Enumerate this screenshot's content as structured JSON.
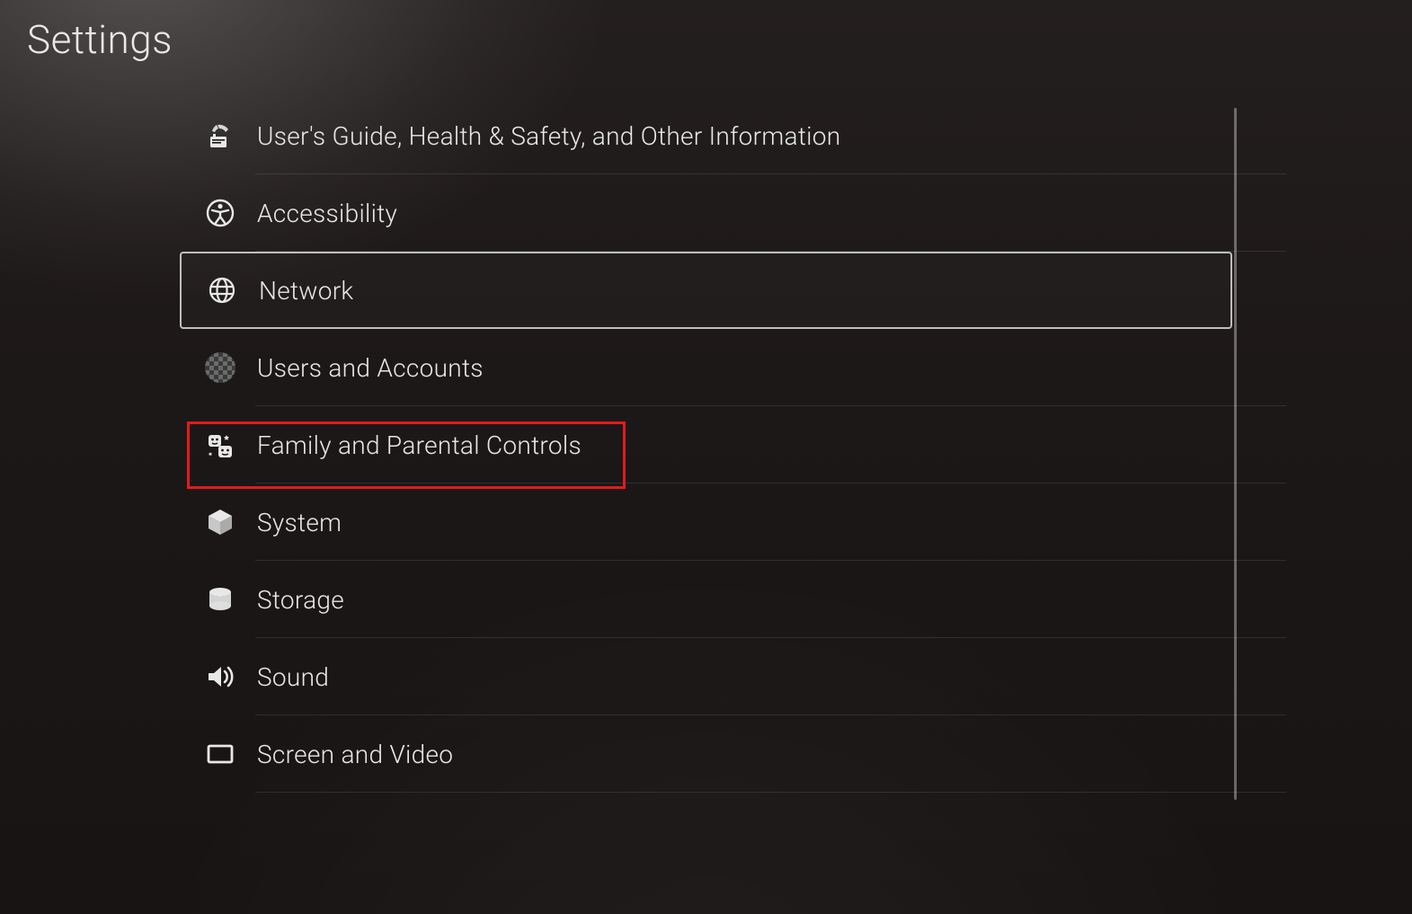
{
  "page_title": "Settings",
  "menu": {
    "items": [
      {
        "id": "guide",
        "label": "User's Guide, Health & Safety, and Other Information",
        "icon": "guide-icon",
        "selected": false,
        "highlight": false
      },
      {
        "id": "accessibility",
        "label": "Accessibility",
        "icon": "accessibility-icon",
        "selected": false,
        "highlight": false
      },
      {
        "id": "network",
        "label": "Network",
        "icon": "globe-icon",
        "selected": true,
        "highlight": false
      },
      {
        "id": "users",
        "label": "Users and Accounts",
        "icon": "avatar-icon",
        "selected": false,
        "highlight": false
      },
      {
        "id": "family",
        "label": "Family and Parental Controls",
        "icon": "family-icon",
        "selected": false,
        "highlight": true
      },
      {
        "id": "system",
        "label": "System",
        "icon": "cube-icon",
        "selected": false,
        "highlight": false
      },
      {
        "id": "storage",
        "label": "Storage",
        "icon": "storage-icon",
        "selected": false,
        "highlight": false
      },
      {
        "id": "sound",
        "label": "Sound",
        "icon": "speaker-icon",
        "selected": false,
        "highlight": false
      },
      {
        "id": "screen",
        "label": "Screen and Video",
        "icon": "screen-icon",
        "selected": false,
        "highlight": false
      }
    ]
  },
  "colors": {
    "highlight_border": "#e21b1b",
    "selection_border": "#d8d8d8"
  }
}
